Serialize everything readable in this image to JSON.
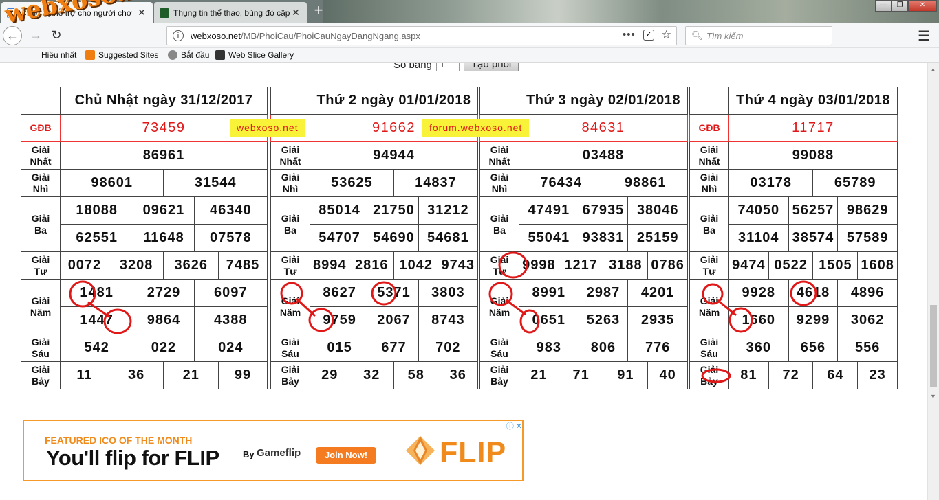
{
  "browser": {
    "tabs": [
      {
        "title": "Cung cụ hỗ trợ cho người chơ",
        "active": true
      },
      {
        "title": "Thụng tin thể thao, búng đỏ cập",
        "active": false
      }
    ],
    "new_tab": "+",
    "url_domain": "webxoso.net",
    "url_path": "/MB/PhoiCau/PhoiCauNgayDangNgang.aspx",
    "url_actions": "•••",
    "search_placeholder": "Tìm kiếm",
    "bookmarks": [
      "Hiều nhất",
      "Suggested Sites",
      "Bắt đầu",
      "Web Slice Gallery"
    ],
    "watermark_logo": "webxoso.net"
  },
  "form": {
    "label": "Số bảng",
    "value": "1",
    "button": "Tạo phôi"
  },
  "tags": [
    "webxoso.net",
    "forum.webxoso.net"
  ],
  "row_labels": {
    "gdb": "GĐB",
    "g1": [
      "Giải",
      "Nhất"
    ],
    "g2": [
      "Giải",
      "Nhì"
    ],
    "g3": [
      "Giải",
      "Ba"
    ],
    "g4": [
      "Giải",
      "Tư"
    ],
    "g5": [
      "Giải",
      "Năm"
    ],
    "g6": [
      "Giải",
      "Sáu"
    ],
    "g7": [
      "Giải",
      "Bảy"
    ]
  },
  "days": [
    {
      "header": "Chủ Nhật ngày 31/12/2017",
      "gdb": "73459",
      "g1": "86961",
      "g2": [
        "98601",
        "31544"
      ],
      "g3": [
        "18088",
        "09621",
        "46340",
        "62551",
        "11648",
        "07578"
      ],
      "g4": [
        "0072",
        "3208",
        "3626",
        "7485"
      ],
      "g5": [
        "1481",
        "2729",
        "6097",
        "1447",
        "9864",
        "4388"
      ],
      "g6": [
        "542",
        "022",
        "024"
      ],
      "g7": [
        "11",
        "36",
        "21",
        "99"
      ]
    },
    {
      "header": "Thứ 2 ngày 01/01/2018",
      "gdb": "91662",
      "g1": "94944",
      "g2": [
        "53625",
        "14837"
      ],
      "g3": [
        "85014",
        "21750",
        "31212",
        "54707",
        "54690",
        "54681"
      ],
      "g4": [
        "8994",
        "2816",
        "1042",
        "9743"
      ],
      "g5": [
        "8627",
        "5371",
        "3803",
        "9759",
        "2067",
        "8743"
      ],
      "g6": [
        "015",
        "677",
        "702"
      ],
      "g7": [
        "29",
        "32",
        "58",
        "36"
      ]
    },
    {
      "header": "Thứ 3 ngày 02/01/2018",
      "gdb": "84631",
      "g1": "03488",
      "g2": [
        "76434",
        "98861"
      ],
      "g3": [
        "47491",
        "67935",
        "38046",
        "55041",
        "93831",
        "25159"
      ],
      "g4": [
        "9998",
        "1217",
        "3188",
        "0786"
      ],
      "g5": [
        "8991",
        "2987",
        "4201",
        "0651",
        "5263",
        "2935"
      ],
      "g6": [
        "983",
        "806",
        "776"
      ],
      "g7": [
        "21",
        "71",
        "91",
        "40"
      ]
    },
    {
      "header": "Thứ 4 ngày 03/01/2018",
      "gdb": "11717",
      "g1": "99088",
      "g2": [
        "03178",
        "65789"
      ],
      "g3": [
        "74050",
        "56257",
        "98629",
        "31104",
        "38574",
        "57589"
      ],
      "g4": [
        "9474",
        "0522",
        "1505",
        "1608"
      ],
      "g5": [
        "9928",
        "4618",
        "4896",
        "1660",
        "9299",
        "3062"
      ],
      "g6": [
        "360",
        "656",
        "556"
      ],
      "g7": [
        "81",
        "72",
        "64",
        "23"
      ]
    }
  ],
  "ad": {
    "kicker": "FEATURED ICO OF THE MONTH",
    "headline": "You'll flip for FLIP",
    "by": "By",
    "brand": "Gameflip",
    "cta": "Join Now!",
    "logo_text": "FLIP",
    "adchoices": "ⓘ ✕"
  },
  "colors": {
    "highlight": "#e01818",
    "tag_bg": "#f8f338",
    "ad_orange": "#f47b20"
  }
}
